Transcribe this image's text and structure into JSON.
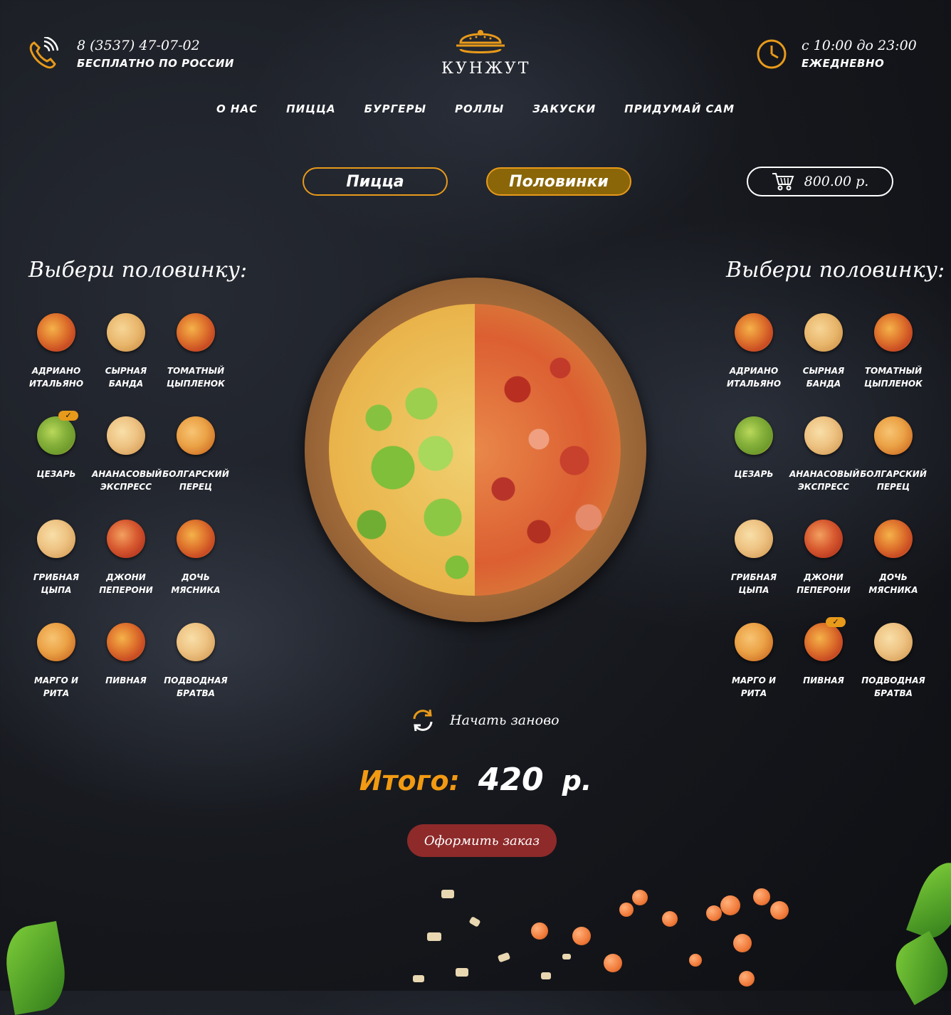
{
  "header": {
    "phone": "8 (3537) 47-07-02",
    "phone_note": "бесплатно по россии",
    "logo_text": "КУНЖУТ",
    "hours": "с 10:00 до 23:00",
    "hours_note": "ежедневно"
  },
  "nav": [
    "О нас",
    "Пицца",
    "Бургеры",
    "Роллы",
    "Закуски",
    "Придумай сам"
  ],
  "tabs": {
    "pizza": "Пицца",
    "halves": "Половинки",
    "active": "halves"
  },
  "cart": {
    "total": "800.00 р."
  },
  "left_panel": {
    "title": "Выбери половинку:",
    "pizzas": [
      {
        "name": "Адриано Итальяно",
        "selected": false
      },
      {
        "name": "Сырная банда",
        "selected": false
      },
      {
        "name": "Томатный цыпленок",
        "selected": false
      },
      {
        "name": "Цезарь",
        "selected": true
      },
      {
        "name": "Ананасовый экспресс",
        "selected": false
      },
      {
        "name": "Болгарский перец",
        "selected": false
      },
      {
        "name": "Грибная цыпа",
        "selected": false
      },
      {
        "name": "Джони пеперони",
        "selected": false
      },
      {
        "name": "Дочь мясника",
        "selected": false
      },
      {
        "name": "Марго и Рита",
        "selected": false
      },
      {
        "name": "Пивная",
        "selected": false
      },
      {
        "name": "Подводная братва",
        "selected": false
      }
    ]
  },
  "right_panel": {
    "title": "Выбери половинку:",
    "pizzas": [
      {
        "name": "Адриано Итальяно",
        "selected": false
      },
      {
        "name": "Сырная банда",
        "selected": false
      },
      {
        "name": "Томатный цыпленок",
        "selected": false
      },
      {
        "name": "Цезарь",
        "selected": false
      },
      {
        "name": "Ананасовый экспресс",
        "selected": false
      },
      {
        "name": "Болгарский перец",
        "selected": false
      },
      {
        "name": "Грибная цыпа",
        "selected": false
      },
      {
        "name": "Джони пеперони",
        "selected": false
      },
      {
        "name": "Дочь мясника",
        "selected": false
      },
      {
        "name": "Марго и Рита",
        "selected": false
      },
      {
        "name": "Пивная",
        "selected": true
      },
      {
        "name": "Подводная братва",
        "selected": false
      }
    ]
  },
  "check_mark": "✓",
  "restart_label": "Начать заново",
  "total": {
    "label": "Итого:",
    "value": "420",
    "currency": "р."
  },
  "order_button": "Оформить заказ",
  "colors": {
    "accent": "#e89a1a",
    "total_label": "#f29a12",
    "order_button": "#8e2a2a",
    "tab_active": "#8a6608"
  }
}
